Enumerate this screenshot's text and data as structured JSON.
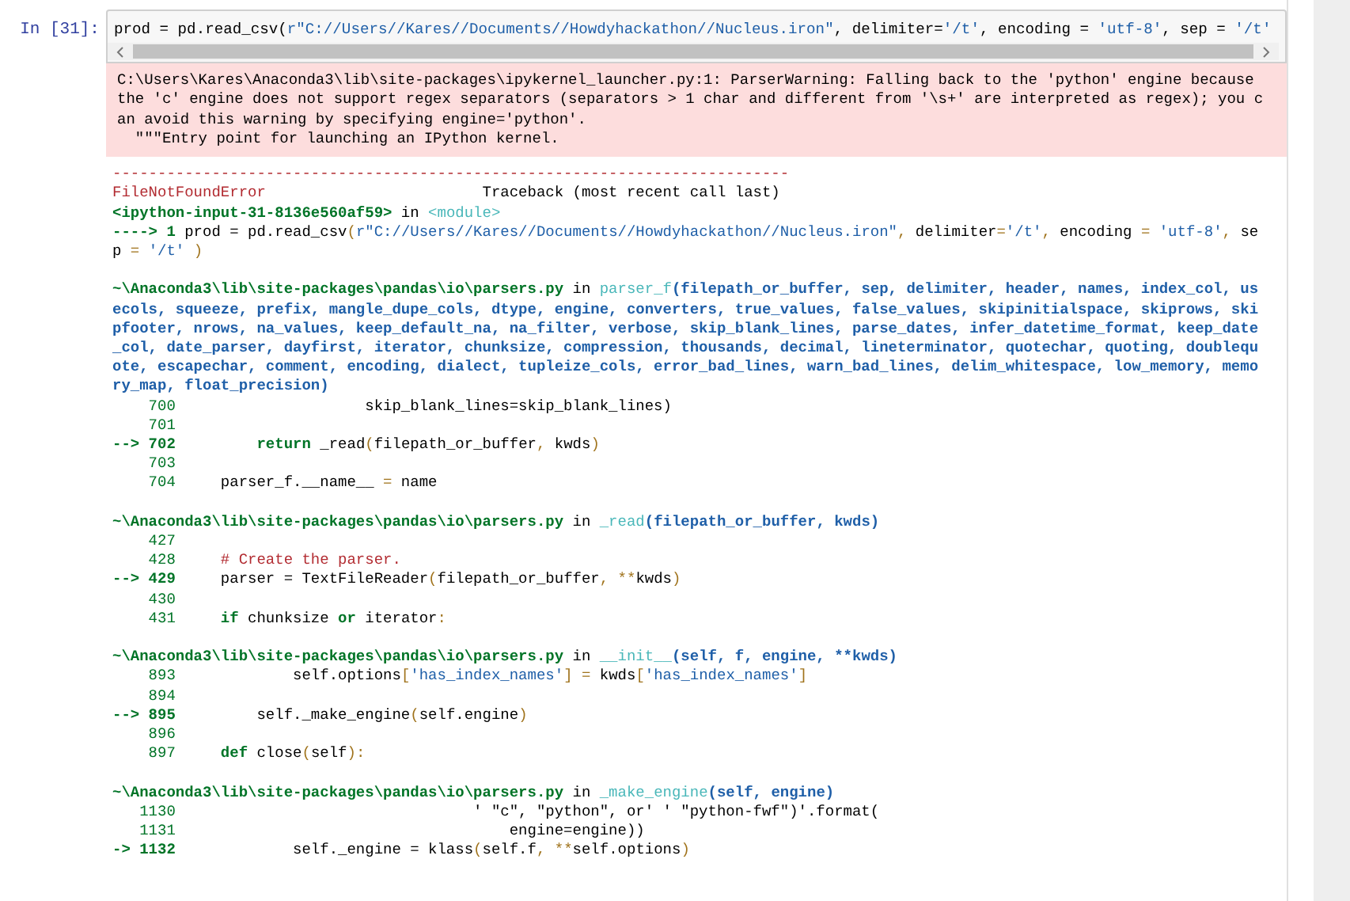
{
  "cell": {
    "prompt": "In [31]:",
    "input": [
      {
        "kind": "t",
        "text": "prod = pd.read_csv("
      },
      {
        "kind": "s",
        "text": "r\"C://Users//Kares//Documents//Howdyhackathon//Nucleus.iron\""
      },
      {
        "kind": "t",
        "text": ", delimiter="
      },
      {
        "kind": "s",
        "text": "'/t'"
      },
      {
        "kind": "t",
        "text": ", encoding = "
      },
      {
        "kind": "s",
        "text": "'utf-8'"
      },
      {
        "kind": "t",
        "text": ", sep = "
      },
      {
        "kind": "s",
        "text": "'/t'"
      }
    ],
    "stderr": [
      "C:\\Users\\Kares\\Anaconda3\\lib\\site-packages\\ipykernel_launcher.py:1: ParserWarning: Falling back to the 'python' engine because",
      "the 'c' engine does not support regex separators (separators > 1 char and different from '\\s+' are interpreted as regex); you c",
      "an avoid this warning by specifying engine='python'.",
      "  \"\"\"Entry point for launching an IPython kernel."
    ],
    "traceback": {
      "rule": "---------------------------------------------------------------------------",
      "error": "FileNotFoundError",
      "heading": "                        Traceback (most recent call last)",
      "frames": [
        {
          "header": [
            [
              {
                "kind": "g",
                "text": "<ipython-input-31-8136e560af59>"
              },
              {
                "kind": "t",
                "text": " in "
              },
              {
                "kind": "m",
                "text": "<module>"
              }
            ]
          ],
          "lines": [
            [
              {
                "kind": "a",
                "text": "----> 1 "
              },
              {
                "kind": "t",
                "text": "prod = pd.read_csv"
              },
              {
                "kind": "o",
                "text": "("
              },
              {
                "kind": "s",
                "text": "r\"C://Users//Kares//Documents//Howdyhackathon//Nucleus.iron\""
              },
              {
                "kind": "o",
                "text": ", "
              },
              {
                "kind": "t",
                "text": "delimiter"
              },
              {
                "kind": "o",
                "text": "="
              },
              {
                "kind": "s",
                "text": "'/t'"
              },
              {
                "kind": "o",
                "text": ", "
              },
              {
                "kind": "t",
                "text": "encoding "
              },
              {
                "kind": "o",
                "text": "= "
              },
              {
                "kind": "s",
                "text": "'utf-8'"
              },
              {
                "kind": "o",
                "text": ", "
              },
              {
                "kind": "t",
                "text": "se"
              }
            ],
            [
              {
                "kind": "t",
                "text": "p "
              },
              {
                "kind": "o",
                "text": "= "
              },
              {
                "kind": "s",
                "text": "'/t'"
              },
              {
                "kind": "o",
                "text": " )"
              }
            ]
          ]
        },
        {
          "header": [
            [
              {
                "kind": "g",
                "text": "~\\Anaconda3\\lib\\site-packages\\pandas\\io\\parsers.py"
              },
              {
                "kind": "t",
                "text": " in "
              },
              {
                "kind": "f",
                "text": "parser_f"
              },
              {
                "kind": "p",
                "text": "(filepath_or_buffer, sep, delimiter, header, names, index_col, us"
              }
            ],
            [
              {
                "kind": "p",
                "text": "ecols, squeeze, prefix, mangle_dupe_cols, dtype, engine, converters, true_values, false_values, skipinitialspace, skiprows, ski"
              }
            ],
            [
              {
                "kind": "p",
                "text": "pfooter, nrows, na_values, keep_default_na, na_filter, verbose, skip_blank_lines, parse_dates, infer_datetime_format, keep_date"
              }
            ],
            [
              {
                "kind": "p",
                "text": "_col, date_parser, dayfirst, iterator, chunksize, compression, thousands, decimal, lineterminator, quotechar, quoting, doublequ"
              }
            ],
            [
              {
                "kind": "p",
                "text": "ote, escapechar, comment, encoding, dialect, tupleize_cols, error_bad_lines, warn_bad_lines, delim_whitespace, low_memory, memo"
              }
            ],
            [
              {
                "kind": "p",
                "text": "ry_map, float_precision)"
              }
            ]
          ],
          "lines": [
            [
              {
                "kind": "n",
                "text": "    700 "
              },
              {
                "kind": "t",
                "text": "                    skip_blank_lines=skip_blank_lines)"
              }
            ],
            [
              {
                "kind": "n",
                "text": "    701"
              }
            ],
            [
              {
                "kind": "a",
                "text": "--> 702         "
              },
              {
                "kind": "k",
                "text": "return"
              },
              {
                "kind": "t",
                "text": " _read"
              },
              {
                "kind": "o",
                "text": "("
              },
              {
                "kind": "t",
                "text": "filepath_or_buffer"
              },
              {
                "kind": "o",
                "text": ", "
              },
              {
                "kind": "t",
                "text": "kwds"
              },
              {
                "kind": "o",
                "text": ")"
              }
            ],
            [
              {
                "kind": "n",
                "text": "    703"
              }
            ],
            [
              {
                "kind": "n",
                "text": "    704 "
              },
              {
                "kind": "t",
                "text": "    parser_f.__name__ "
              },
              {
                "kind": "o",
                "text": "="
              },
              {
                "kind": "t",
                "text": " name"
              }
            ]
          ]
        },
        {
          "header": [
            [
              {
                "kind": "g",
                "text": "~\\Anaconda3\\lib\\site-packages\\pandas\\io\\parsers.py"
              },
              {
                "kind": "t",
                "text": " in "
              },
              {
                "kind": "f",
                "text": "_read"
              },
              {
                "kind": "p",
                "text": "(filepath_or_buffer, kwds)"
              }
            ]
          ],
          "lines": [
            [
              {
                "kind": "n",
                "text": "    427"
              }
            ],
            [
              {
                "kind": "n",
                "text": "    428     "
              },
              {
                "kind": "c",
                "text": "# Create the parser."
              }
            ],
            [
              {
                "kind": "a",
                "text": "--> 429 "
              },
              {
                "kind": "t",
                "text": "    parser = TextFileReader"
              },
              {
                "kind": "o",
                "text": "("
              },
              {
                "kind": "t",
                "text": "filepath_or_buffer"
              },
              {
                "kind": "o",
                "text": ", **"
              },
              {
                "kind": "t",
                "text": "kwds"
              },
              {
                "kind": "o",
                "text": ")"
              }
            ],
            [
              {
                "kind": "n",
                "text": "    430"
              }
            ],
            [
              {
                "kind": "n",
                "text": "    431     "
              },
              {
                "kind": "k",
                "text": "if"
              },
              {
                "kind": "t",
                "text": " chunksize "
              },
              {
                "kind": "k",
                "text": "or"
              },
              {
                "kind": "t",
                "text": " iterator"
              },
              {
                "kind": "o",
                "text": ":"
              }
            ]
          ]
        },
        {
          "header": [
            [
              {
                "kind": "g",
                "text": "~\\Anaconda3\\lib\\site-packages\\pandas\\io\\parsers.py"
              },
              {
                "kind": "t",
                "text": " in "
              },
              {
                "kind": "f",
                "text": "__init__"
              },
              {
                "kind": "p",
                "text": "(self, f, engine, **kwds)"
              }
            ]
          ],
          "lines": [
            [
              {
                "kind": "n",
                "text": "    893 "
              },
              {
                "kind": "t",
                "text": "            self.options"
              },
              {
                "kind": "o",
                "text": "["
              },
              {
                "kind": "s",
                "text": "'has_index_names'"
              },
              {
                "kind": "o",
                "text": "] = "
              },
              {
                "kind": "t",
                "text": "kwds"
              },
              {
                "kind": "o",
                "text": "["
              },
              {
                "kind": "s",
                "text": "'has_index_names'"
              },
              {
                "kind": "o",
                "text": "]"
              }
            ],
            [
              {
                "kind": "n",
                "text": "    894"
              }
            ],
            [
              {
                "kind": "a",
                "text": "--> 895 "
              },
              {
                "kind": "t",
                "text": "        self._make_engine"
              },
              {
                "kind": "o",
                "text": "("
              },
              {
                "kind": "t",
                "text": "self.engine"
              },
              {
                "kind": "o",
                "text": ")"
              }
            ],
            [
              {
                "kind": "n",
                "text": "    896"
              }
            ],
            [
              {
                "kind": "n",
                "text": "    897     "
              },
              {
                "kind": "k",
                "text": "def"
              },
              {
                "kind": "t",
                "text": " close"
              },
              {
                "kind": "o",
                "text": "("
              },
              {
                "kind": "t",
                "text": "self"
              },
              {
                "kind": "o",
                "text": "):"
              }
            ]
          ]
        },
        {
          "header": [
            [
              {
                "kind": "g",
                "text": "~\\Anaconda3\\lib\\site-packages\\pandas\\io\\parsers.py"
              },
              {
                "kind": "t",
                "text": " in "
              },
              {
                "kind": "f",
                "text": "_make_engine"
              },
              {
                "kind": "p",
                "text": "(self, engine)"
              }
            ]
          ],
          "lines": [
            [
              {
                "kind": "n",
                "text": "   1130 "
              },
              {
                "kind": "t",
                "text": "                                ' \"c\", \"python\", or' ' \"python-fwf\")'.format("
              }
            ],
            [
              {
                "kind": "n",
                "text": "   1131 "
              },
              {
                "kind": "t",
                "text": "                                    engine=engine))"
              }
            ],
            [
              {
                "kind": "a",
                "text": "-> 1132 "
              },
              {
                "kind": "t",
                "text": "            self._engine = klass"
              },
              {
                "kind": "o",
                "text": "("
              },
              {
                "kind": "t",
                "text": "self.f"
              },
              {
                "kind": "o",
                "text": ", **"
              },
              {
                "kind": "t",
                "text": "self.options"
              },
              {
                "kind": "o",
                "text": ")"
              }
            ]
          ]
        }
      ]
    }
  }
}
